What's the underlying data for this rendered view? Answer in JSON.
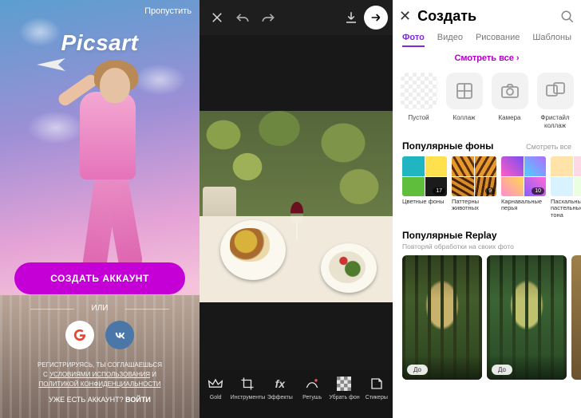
{
  "screen1": {
    "skip": "Пропустить",
    "brand": "Picsart",
    "create_account": "СОЗДАТЬ АККАУНТ",
    "or": "ИЛИ",
    "google": "G",
    "vk": "VK",
    "terms_l1": "РЕГИСТРИРУЯСЬ, ТЫ СОГЛАШАЕШЬСЯ",
    "terms_l2a": "С ",
    "terms_l2b": "УСЛОВИЯМИ ИСПОЛЬЗОВАНИЯ",
    "terms_l2c": " И",
    "terms_l3": "ПОЛИТИКОЙ КОНФИДЕНЦИАЛЬНОСТИ",
    "login_q": "УЖЕ ЕСТЬ АККАУНТ? ",
    "login_a": "ВОЙТИ"
  },
  "screen2": {
    "tools": {
      "gold": "Gold",
      "crop": "Инструменты",
      "fx": "Эффекты",
      "retouch": "Ретушь",
      "remove": "Убрать фон",
      "stickers": "Стикеры"
    },
    "fx_glyph": "fx"
  },
  "screen3": {
    "title": "Создать",
    "tabs": {
      "photo": "Фото",
      "video": "Видео",
      "draw": "Рисование",
      "tpl": "Шаблоны"
    },
    "see_all": "Смотреть все ›",
    "tiles": {
      "empty": "Пустой",
      "collage": "Коллаж",
      "camera": "Камера",
      "freestyle": "Фристайл коллаж"
    },
    "bg_section": "Популярные фоны",
    "bg_see": "Смотреть все",
    "bg_cards": [
      {
        "label": "Цветные фоны",
        "badge": "17"
      },
      {
        "label": "Паттерны животных",
        "badge": "9"
      },
      {
        "label": "Карнавальные перья",
        "badge": "10"
      },
      {
        "label": "Пасхальные пастельные тона",
        "badge": ""
      }
    ],
    "replay_section": "Популярные Replay",
    "replay_sub": "Повторяй обработки на своих фото",
    "replay_tag": "До"
  }
}
